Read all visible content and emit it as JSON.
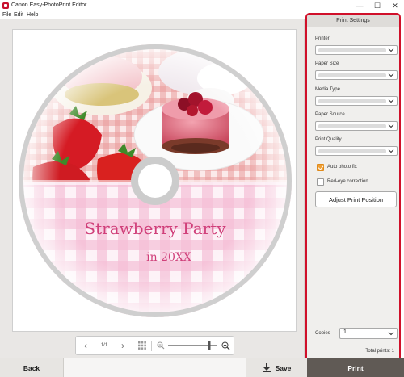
{
  "window": {
    "title": "Canon Easy-PhotoPrint Editor",
    "minimize_glyph": "—",
    "maximize_glyph": "☐",
    "close_glyph": "✕"
  },
  "menu": [
    "File",
    "Edit",
    "Help"
  ],
  "disc": {
    "line1": "Strawberry Party",
    "line2": "in 20XX",
    "text_color": "#d0407a"
  },
  "navigation": {
    "page_indicator": "1/1",
    "zoom_level": 0.85
  },
  "print_settings": {
    "header": "Print Settings",
    "printer": {
      "label": "Printer",
      "value": ""
    },
    "paper_size": {
      "label": "Paper Size",
      "value": ""
    },
    "media_type": {
      "label": "Media Type",
      "value": ""
    },
    "paper_source": {
      "label": "Paper Source",
      "value": ""
    },
    "print_quality": {
      "label": "Print Quality",
      "value": ""
    },
    "auto_photo_fix": {
      "label": "Auto photo fix",
      "checked": true
    },
    "red_eye_correction": {
      "label": "Red-eye correction",
      "checked": false
    },
    "adjust_button": "Adjust Print Position",
    "copies": {
      "label": "Copies",
      "value": "1"
    },
    "total_prints": "Total prints: 1",
    "highlight_color": "#d0102a",
    "checkbox_color": "#f0a035"
  },
  "footer": {
    "back": "Back",
    "save": "Save",
    "print": "Print"
  }
}
